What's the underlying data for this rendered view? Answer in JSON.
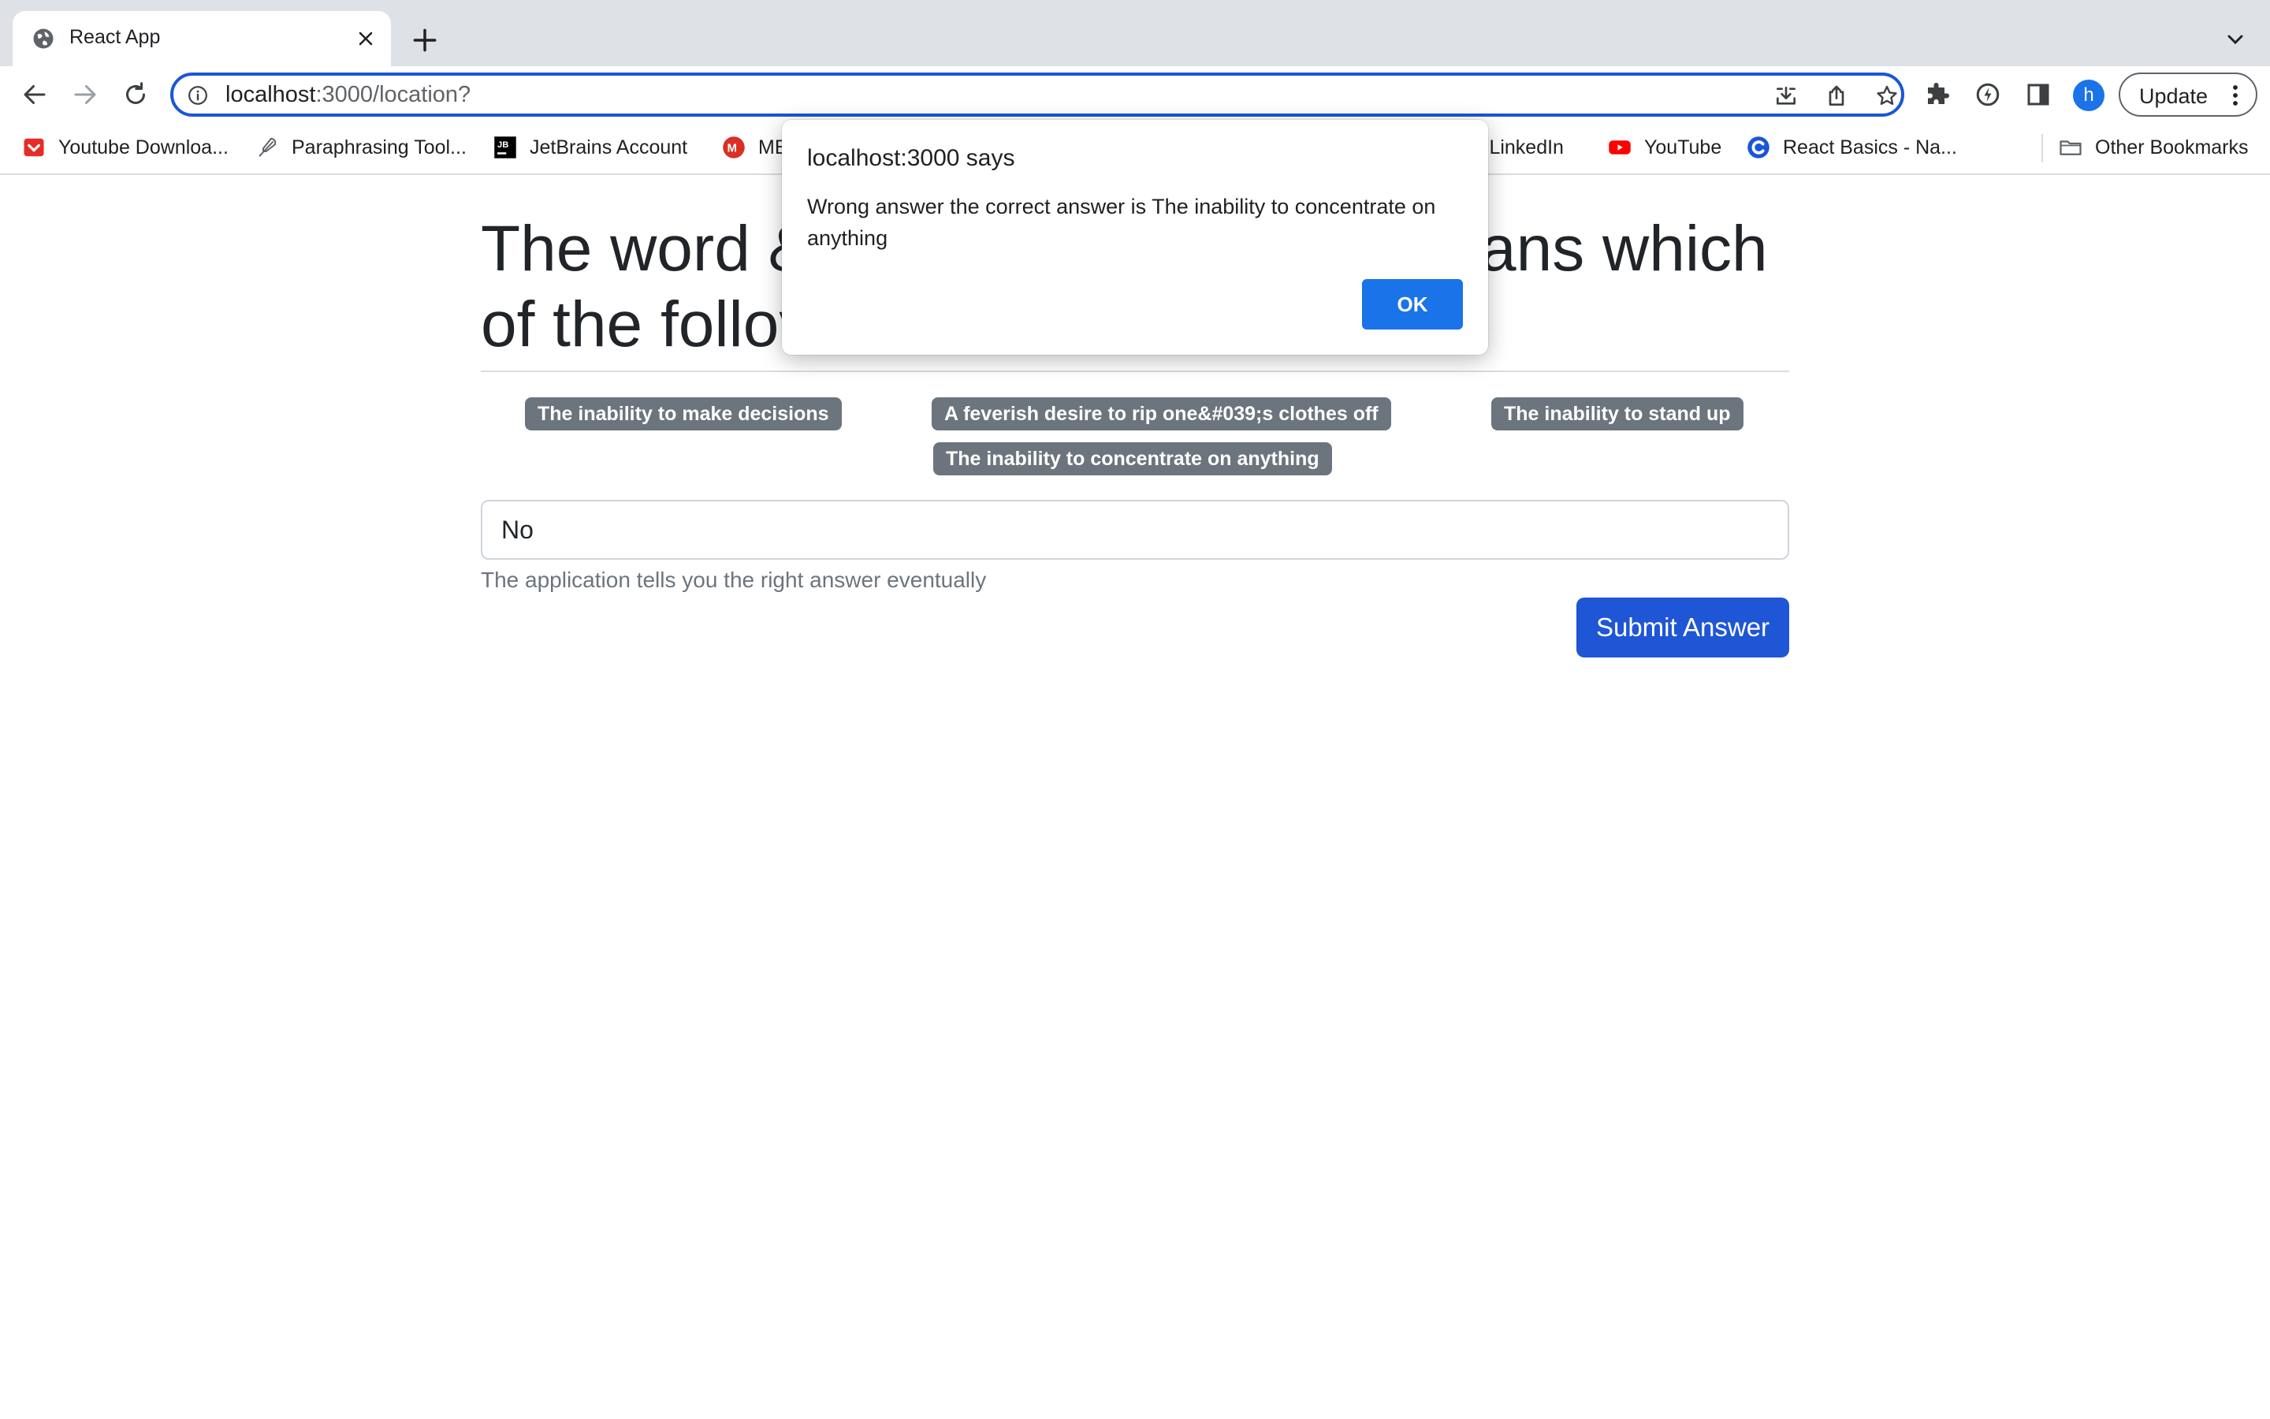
{
  "browser": {
    "tab": {
      "title": "React App",
      "favicon": "globe-icon"
    },
    "address_bar": {
      "host": "localhost",
      "path": ":3000/location?"
    },
    "update_label": "Update",
    "avatar_initial": "h",
    "accent_color": "#1a73e8"
  },
  "bookmarks": [
    {
      "label": "Youtube Downloa...",
      "icon": "red-download-icon"
    },
    {
      "label": "Paraphrasing Tool...",
      "icon": "feather-icon"
    },
    {
      "label": "JetBrains Account",
      "icon": "jetbrains-icon"
    },
    {
      "label": "ME",
      "icon": "red-m-icon"
    },
    {
      "label": "| LinkedIn",
      "icon": "none"
    },
    {
      "label": "YouTube",
      "icon": "youtube-icon"
    },
    {
      "label": "React Basics - Na...",
      "icon": "blue-c-icon"
    },
    {
      "label": "Other Bookmarks",
      "icon": "folder-icon"
    }
  ],
  "page": {
    "title_line1_left": "The word &",
    "title_line1_right": "ans which",
    "title_line2_left": "of the follov",
    "options": [
      "The inability to make decisions",
      "A feverish desire to rip one&#039;s clothes off",
      "The inability to stand up",
      "The inability to concentrate on anything"
    ],
    "answer_value": "No",
    "helper_text": "The application tells you the right answer eventually",
    "submit_label": "Submit Answer",
    "button_color": "#1f56d6",
    "badge_color": "#6c757d"
  },
  "dialog": {
    "title": "localhost:3000 says",
    "message": "Wrong answer the correct answer is The inability to concentrate on anything",
    "ok_label": "OK"
  }
}
